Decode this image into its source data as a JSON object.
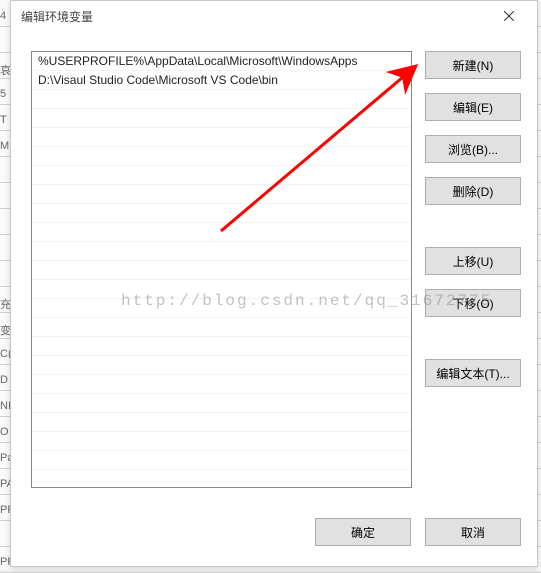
{
  "dialog": {
    "title": "编辑环境变量",
    "close_tooltip": "关闭"
  },
  "list": {
    "items": [
      "%USERPROFILE%\\AppData\\Local\\Microsoft\\WindowsApps",
      "D:\\Visaul Studio Code\\Microsoft VS Code\\bin"
    ]
  },
  "buttons": {
    "new": "新建(N)",
    "edit": "编辑(E)",
    "browse": "浏览(B)...",
    "delete": "删除(D)",
    "move_up": "上移(U)",
    "move_down": "下移(O)",
    "edit_text": "编辑文本(T)...",
    "ok": "确定",
    "cancel": "取消"
  },
  "watermark": "http://blog.csdn.net/qq_31672775",
  "backdrop_rows": [
    "4",
    "",
    "哀",
    "5",
    "T",
    "M",
    "",
    "",
    "",
    "",
    "",
    "充",
    "变",
    "C(",
    "D",
    "NI",
    "O",
    "Pa",
    "PA",
    "PF",
    "",
    "PR"
  ]
}
